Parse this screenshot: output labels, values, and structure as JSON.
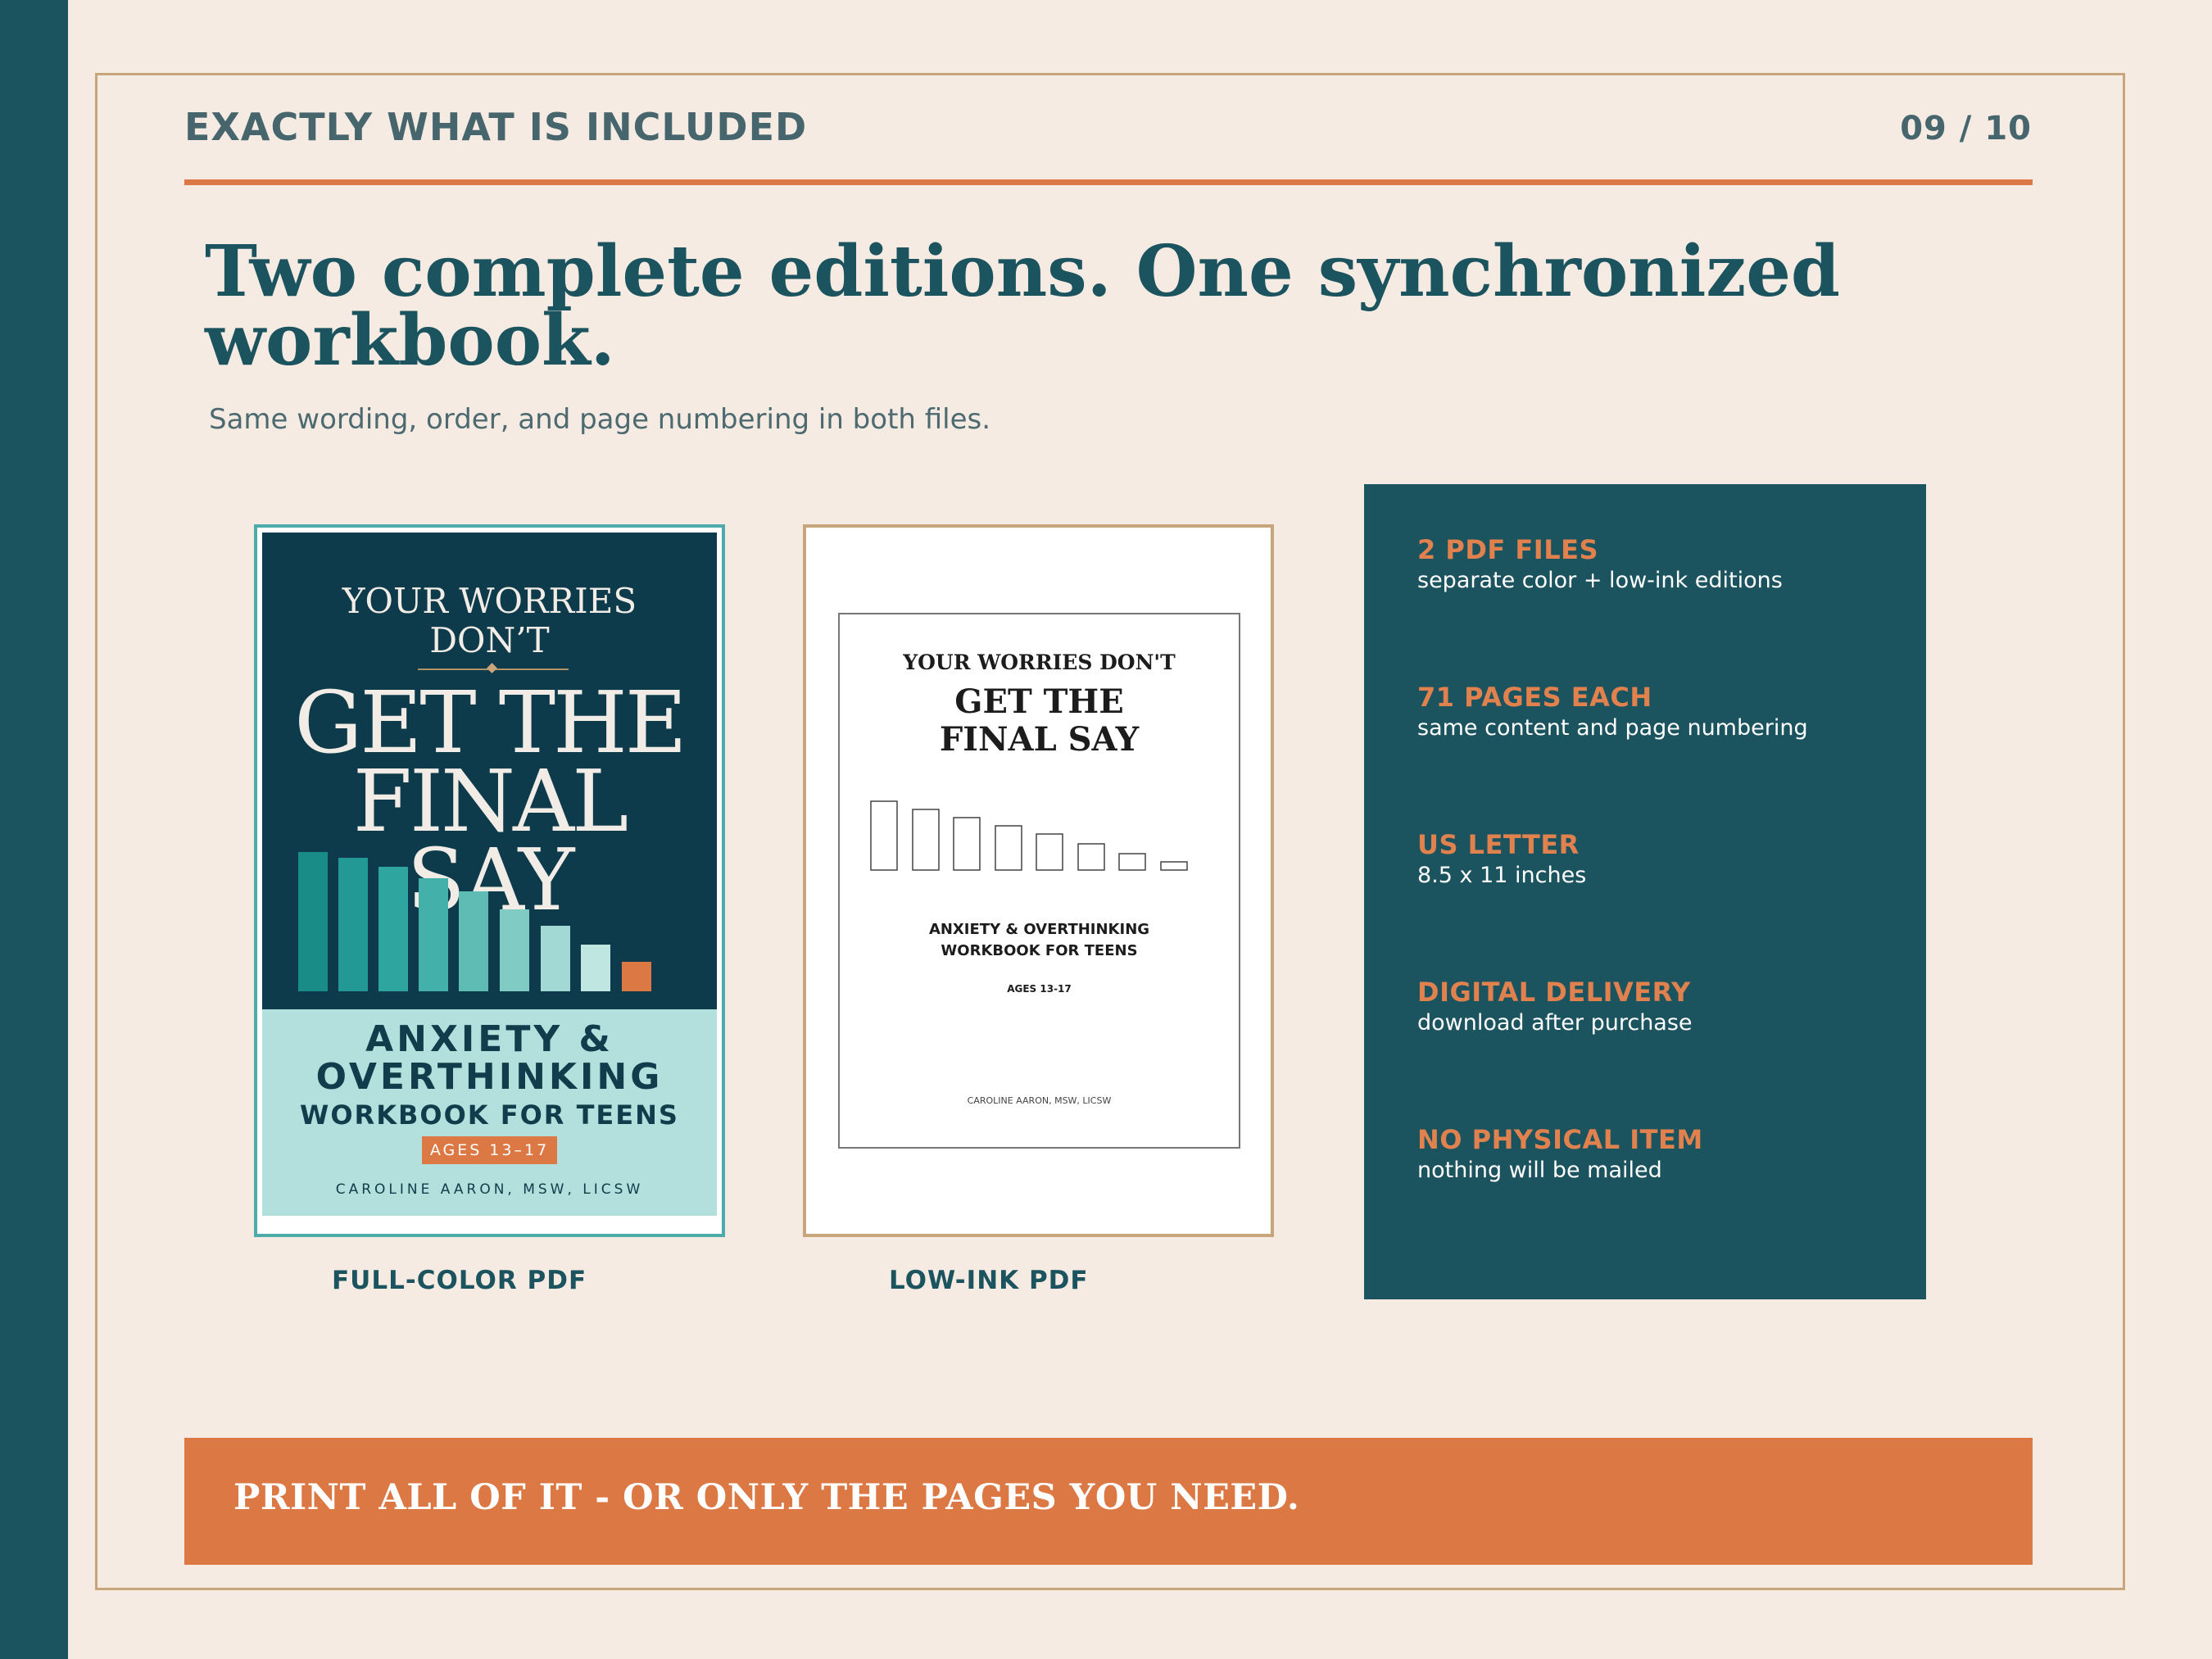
{
  "header": {
    "section_title": "EXACTLY WHAT IS INCLUDED",
    "page_number": "09 / 10"
  },
  "headline": "Two complete editions. One synchronized workbook.",
  "subline": "Same wording, order, and page numbering in both files.",
  "color_cover": {
    "line1": "YOUR WORRIES DON’T",
    "line2": "GET THE FINAL SAY",
    "line3": "ANXIETY & OVERTHINKING",
    "line4": "WORKBOOK FOR TEENS",
    "ages": "AGES 13–17",
    "author": "CAROLINE AARON, MSW, LICSW",
    "caption": "FULL-COLOR PDF"
  },
  "lowink_cover": {
    "line1": "YOUR WORRIES DON'T",
    "line2": "GET THE FINAL SAY",
    "line3": "ANXIETY & OVERTHINKING WORKBOOK FOR TEENS",
    "ages": "AGES 13-17",
    "author": "CAROLINE AARON, MSW, LICSW",
    "caption": "LOW-INK PDF"
  },
  "info": [
    {
      "title": "2 PDF FILES",
      "detail": "separate color + low-ink editions"
    },
    {
      "title": "71 PAGES EACH",
      "detail": "same content and page numbering"
    },
    {
      "title": "US LETTER",
      "detail": "8.5 x 11 inches"
    },
    {
      "title": "DIGITAL DELIVERY",
      "detail": "download after purchase"
    },
    {
      "title": "NO PHYSICAL ITEM",
      "detail": "nothing will be mailed"
    }
  ],
  "banner": "PRINT ALL OF IT - OR ONLY THE PAGES YOU NEED.",
  "colors": {
    "teal": "#1b535f",
    "orange": "#dc7844",
    "cream": "#f5ebe2",
    "gold": "#c9a57c"
  }
}
